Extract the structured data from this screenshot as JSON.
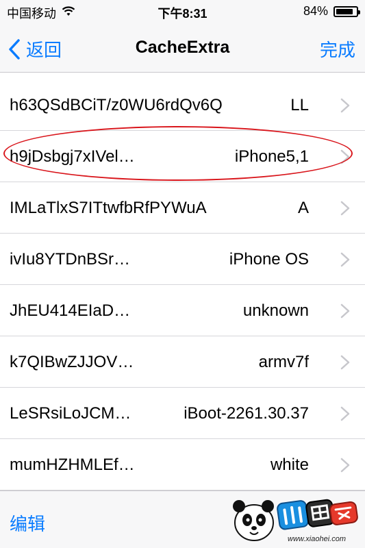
{
  "status_bar": {
    "carrier": "中国移动",
    "time": "下午8:31",
    "battery_percent": "84%",
    "battery_level": 0.84
  },
  "nav": {
    "back_label": "返回",
    "title": "CacheExtra",
    "done_label": "完成"
  },
  "rows": [
    {
      "key": "h63QSdBCiT/z0WU6rdQv6Q",
      "value": "LL"
    },
    {
      "key": "h9jDsbgj7xIVel…",
      "value": "iPhone5,1"
    },
    {
      "key": "IMLaTlxS7ITtwfbRfPYWuA",
      "value": "A"
    },
    {
      "key": "ivIu8YTDnBSr…",
      "value": "iPhone OS"
    },
    {
      "key": "JhEU414EIaD…",
      "value": "unknown"
    },
    {
      "key": "k7QIBwZJJOV…",
      "value": "armv7f"
    },
    {
      "key": "LeSRsiLoJCM…",
      "value": "iBoot-2261.30.37"
    },
    {
      "key": "mumHZHMLEf…",
      "value": "white"
    }
  ],
  "toolbar": {
    "edit_label": "编辑"
  },
  "watermark": {
    "url": "www.xiaohei.com"
  },
  "colors": {
    "accent": "#0a7cff",
    "highlight": "#d9151b"
  },
  "icons": [
    "wifi-icon",
    "battery-icon",
    "chevron-left-icon",
    "chevron-right-icon",
    "panda-logo-icon"
  ]
}
